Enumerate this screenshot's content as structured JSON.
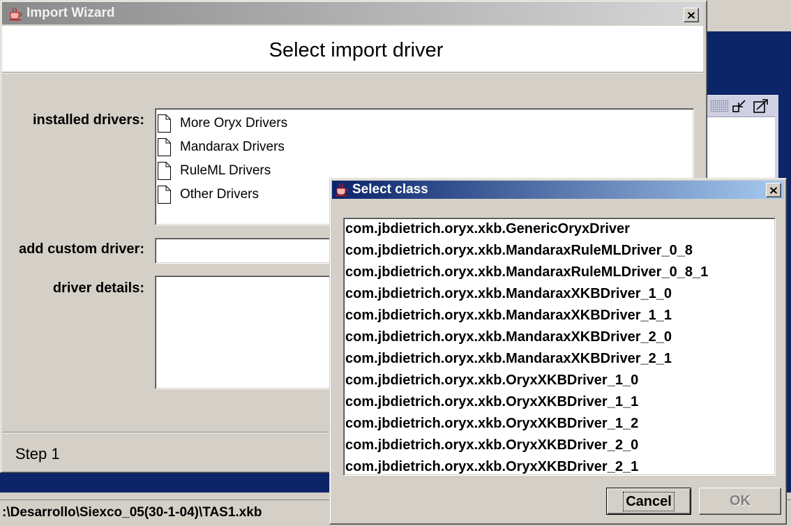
{
  "wizard": {
    "title": "Import Wizard",
    "title_icon": "java-cup-icon",
    "close_icon": "close-icon",
    "header": "Select import driver",
    "installed_drivers_label": "installed drivers:",
    "installed_drivers": [
      {
        "label": "More Oryx Drivers",
        "icon": "document-icon"
      },
      {
        "label": "Mandarax Drivers",
        "icon": "document-icon"
      },
      {
        "label": "RuleML Drivers",
        "icon": "document-icon"
      },
      {
        "label": "Other Drivers",
        "icon": "document-icon"
      }
    ],
    "custom_driver_label": "add custom driver:",
    "custom_driver_value": "",
    "driver_details_label": "driver details:",
    "driver_details_value": "",
    "step": "Step 1"
  },
  "select_class": {
    "title": "Select class",
    "title_icon": "java-cup-icon",
    "close_icon": "close-icon",
    "classes": [
      "com.jbdietrich.oryx.xkb.GenericOryxDriver",
      "com.jbdietrich.oryx.xkb.MandaraxRuleMLDriver_0_8",
      "com.jbdietrich.oryx.xkb.MandaraxRuleMLDriver_0_8_1",
      "com.jbdietrich.oryx.xkb.MandaraxXKBDriver_1_0",
      "com.jbdietrich.oryx.xkb.MandaraxXKBDriver_1_1",
      "com.jbdietrich.oryx.xkb.MandaraxXKBDriver_2_0",
      "com.jbdietrich.oryx.xkb.MandaraxXKBDriver_2_1",
      "com.jbdietrich.oryx.xkb.OryxXKBDriver_1_0",
      "com.jbdietrich.oryx.xkb.OryxXKBDriver_1_1",
      "com.jbdietrich.oryx.xkb.OryxXKBDriver_1_2",
      "com.jbdietrich.oryx.xkb.OryxXKBDriver_2_0",
      "com.jbdietrich.oryx.xkb.OryxXKBDriver_2_1"
    ],
    "cancel_label": "Cancel",
    "ok_label": "OK",
    "ok_enabled": false
  },
  "background": {
    "status_path": ":\\Desarrollo\\Siexco_05(30-1-04)\\TAS1.xkb",
    "internal_frame_icons": [
      "iconify-icon",
      "maximize-icon"
    ]
  },
  "colors": {
    "window_face": "#d4d0c8",
    "desktop": "#0c2468",
    "active_title_start": "#0a246a",
    "active_title_end": "#a6caf0",
    "inactive_title_start": "#8a8a8a",
    "inactive_title_end": "#d6d6d6",
    "disabled_text": "#808080"
  }
}
